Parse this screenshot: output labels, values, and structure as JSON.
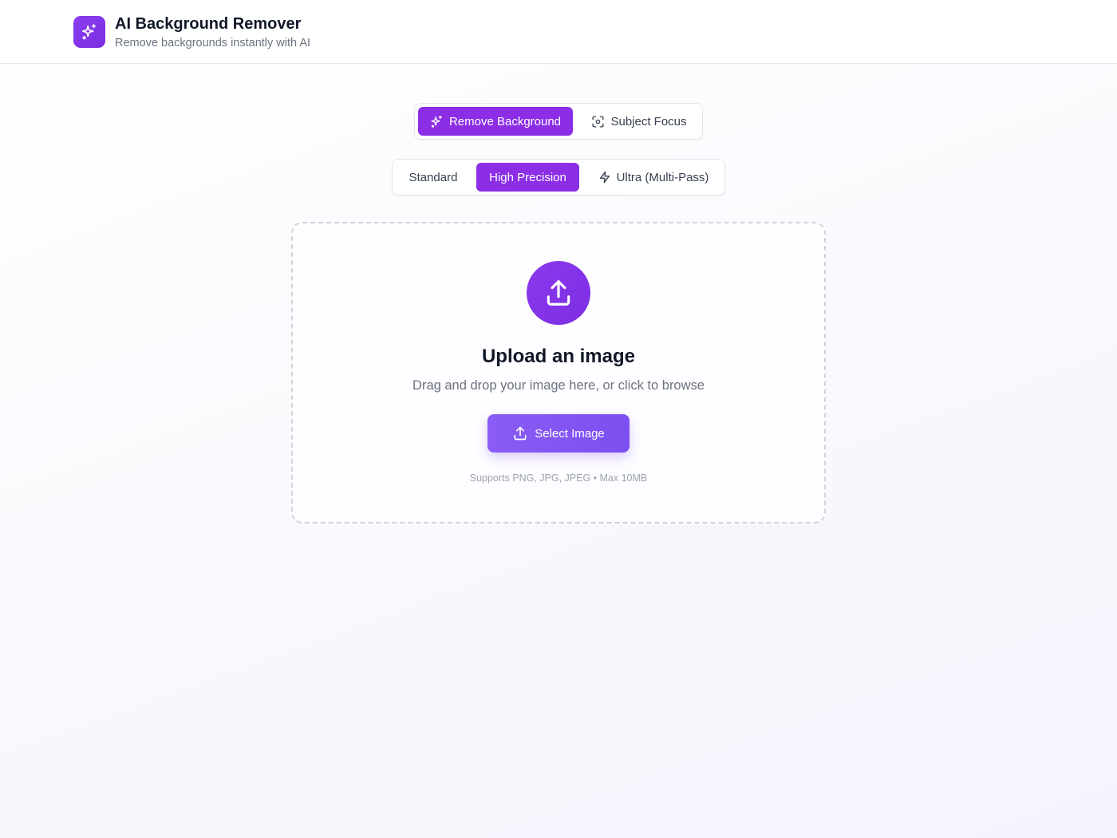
{
  "header": {
    "title": "AI Background Remover",
    "subtitle": "Remove backgrounds instantly with AI",
    "logo_icon": "sparkles-icon",
    "brand_color": "#8b2ee6"
  },
  "mode_tabs": [
    {
      "label": "Remove Background",
      "icon": "sparkles-icon",
      "active": true
    },
    {
      "label": "Subject Focus",
      "icon": "focus-scan-icon",
      "active": false
    }
  ],
  "quality_tabs": [
    {
      "label": "Standard",
      "active": false
    },
    {
      "label": "High Precision",
      "active": true
    },
    {
      "label": "Ultra (Multi-Pass)",
      "icon": "lightning-icon",
      "active": false
    }
  ],
  "upload": {
    "icon": "upload-icon",
    "title": "Upload an image",
    "description": "Drag and drop your image here, or click to browse",
    "button_label": "Select Image",
    "supports_text": "Supports PNG, JPG, JPEG • Max 10MB"
  }
}
